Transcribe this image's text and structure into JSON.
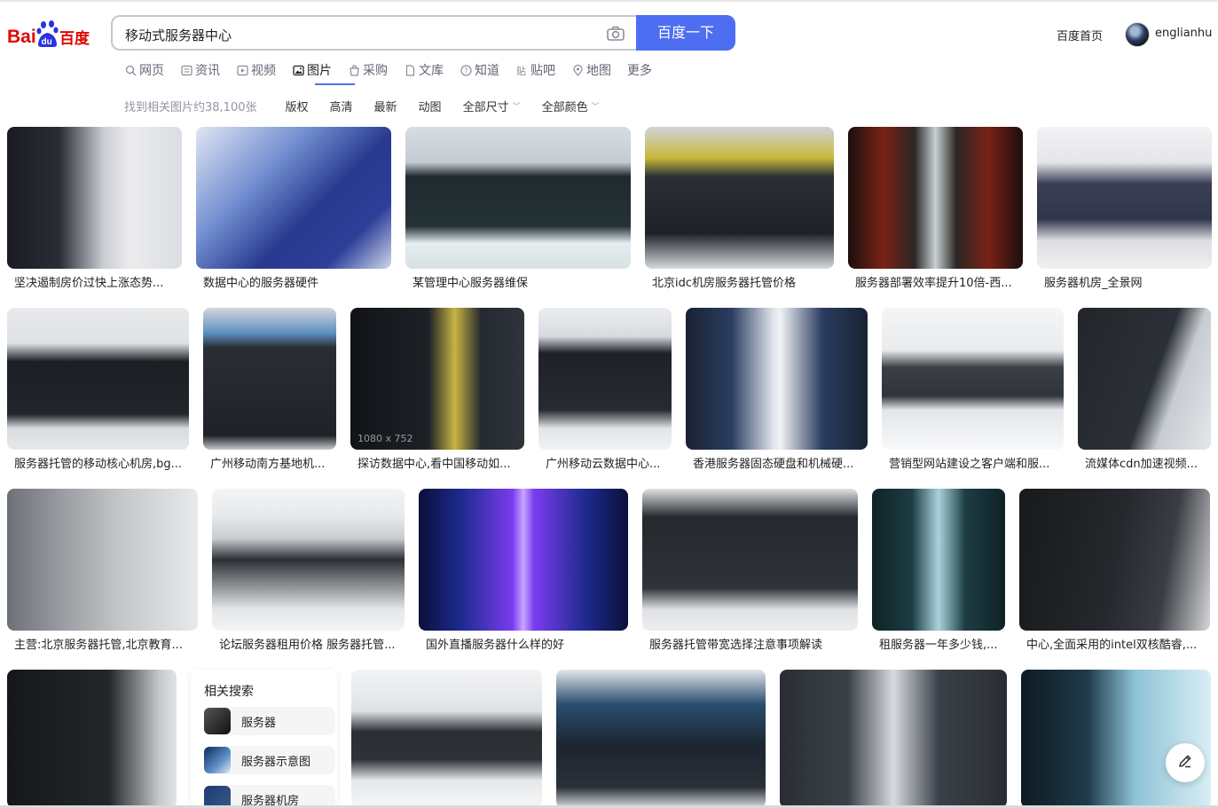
{
  "header": {
    "search_query": "移动式服务器中心",
    "search_button": "百度一下",
    "home_link": "百度首页",
    "username": "englianhu",
    "accent_color": "#4e6ef2"
  },
  "tabs": [
    {
      "label": "网页",
      "icon": "search-icon"
    },
    {
      "label": "资讯",
      "icon": "news-icon"
    },
    {
      "label": "视频",
      "icon": "video-icon"
    },
    {
      "label": "图片",
      "icon": "image-icon",
      "active": true
    },
    {
      "label": "采购",
      "icon": "purchase-icon"
    },
    {
      "label": "文库",
      "icon": "document-icon"
    },
    {
      "label": "知道",
      "icon": "question-icon"
    },
    {
      "label": "贴吧",
      "icon": "tieba-icon"
    },
    {
      "label": "地图",
      "icon": "map-icon"
    },
    {
      "label": "更多",
      "icon": ""
    }
  ],
  "filters": {
    "result_count": "找到相关图片约38,100张",
    "items": [
      "版权",
      "高清",
      "最新",
      "动图"
    ],
    "size_dropdown": "全部尺寸",
    "color_dropdown": "全部颜色"
  },
  "results": {
    "row1": [
      "坚决遏制房价过快上涨态势...",
      "数据中心的服务器硬件",
      "某管理中心服务器维保",
      "北京idc机房服务器托管价格",
      "服务器部署效率提升10倍-西...",
      "服务器机房_全景网"
    ],
    "row2": [
      "服务器托管的移动核心机房,bg...",
      "广州移动南方基地机...",
      "探访数据中心,看中国移动如...",
      "广州移动云数据中心...",
      "香港服务器固态硬盘和机械硬...",
      "营销型网站建设之客户端和服...",
      "流媒体cdn加速视频..."
    ],
    "row2_dimension_label": "1080 x 752",
    "row3": [
      "主营:北京服务器托管,北京教育...",
      "论坛服务器租用价格 服务器托管...",
      "国外直播服务器什么样的好",
      "服务器托管带宽选择注意事项解读",
      "租服务器一年多少钱,...",
      "中心,全面采用的intel双核酷睿,..."
    ]
  },
  "related_search": {
    "title": "相关搜索",
    "items": [
      "服务器",
      "服务器示意图",
      "服务器机房"
    ]
  }
}
